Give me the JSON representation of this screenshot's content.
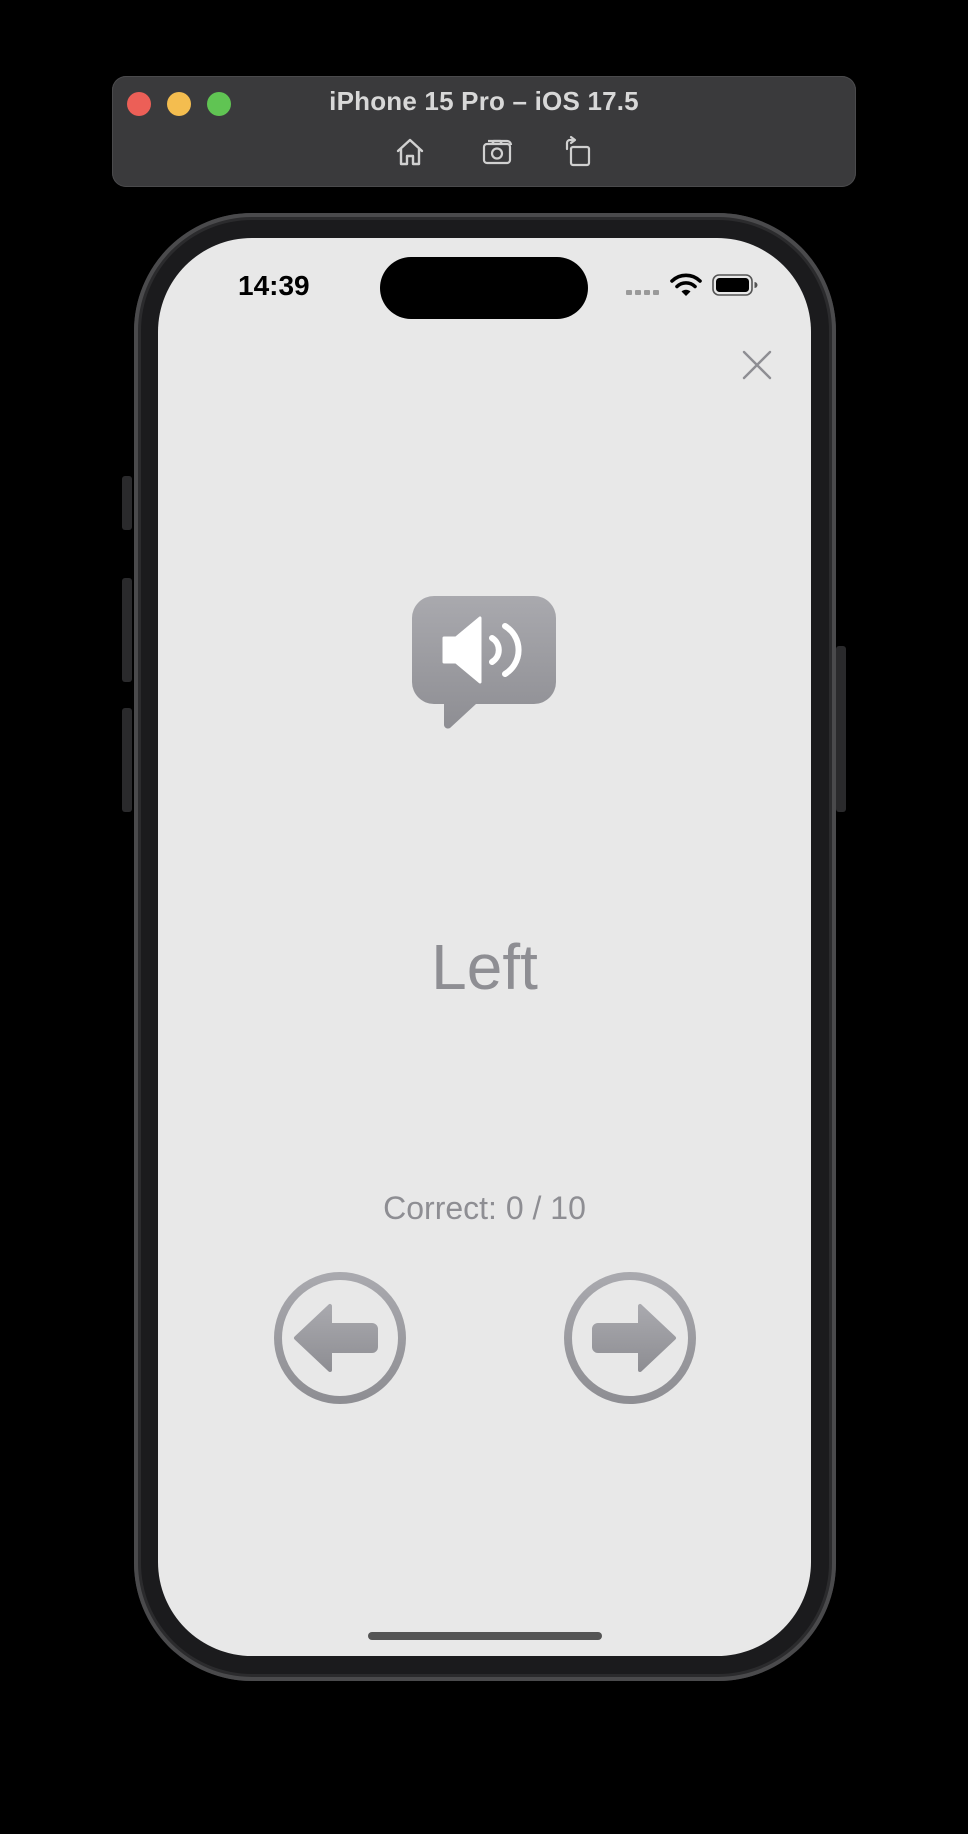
{
  "simulator": {
    "title": "iPhone 15 Pro – iOS 17.5",
    "toolbar_icons": [
      "home-icon",
      "screenshot-icon",
      "rotate-icon"
    ]
  },
  "status_bar": {
    "time": "14:39",
    "icons": [
      "cellular-icon",
      "wifi-icon",
      "battery-icon"
    ]
  },
  "quiz": {
    "word": "Left",
    "score_text": "Correct: 0 / 10",
    "icons": [
      "close-icon",
      "speaker-bubble-icon",
      "arrow-left-circle-icon",
      "arrow-right-circle-icon"
    ]
  },
  "colors": {
    "screen_background": "#e8e8e8",
    "accent_gray": "#8e8e93",
    "traffic_red": "#ec5f57",
    "traffic_yellow": "#f4bd4f",
    "traffic_green": "#60c453"
  }
}
